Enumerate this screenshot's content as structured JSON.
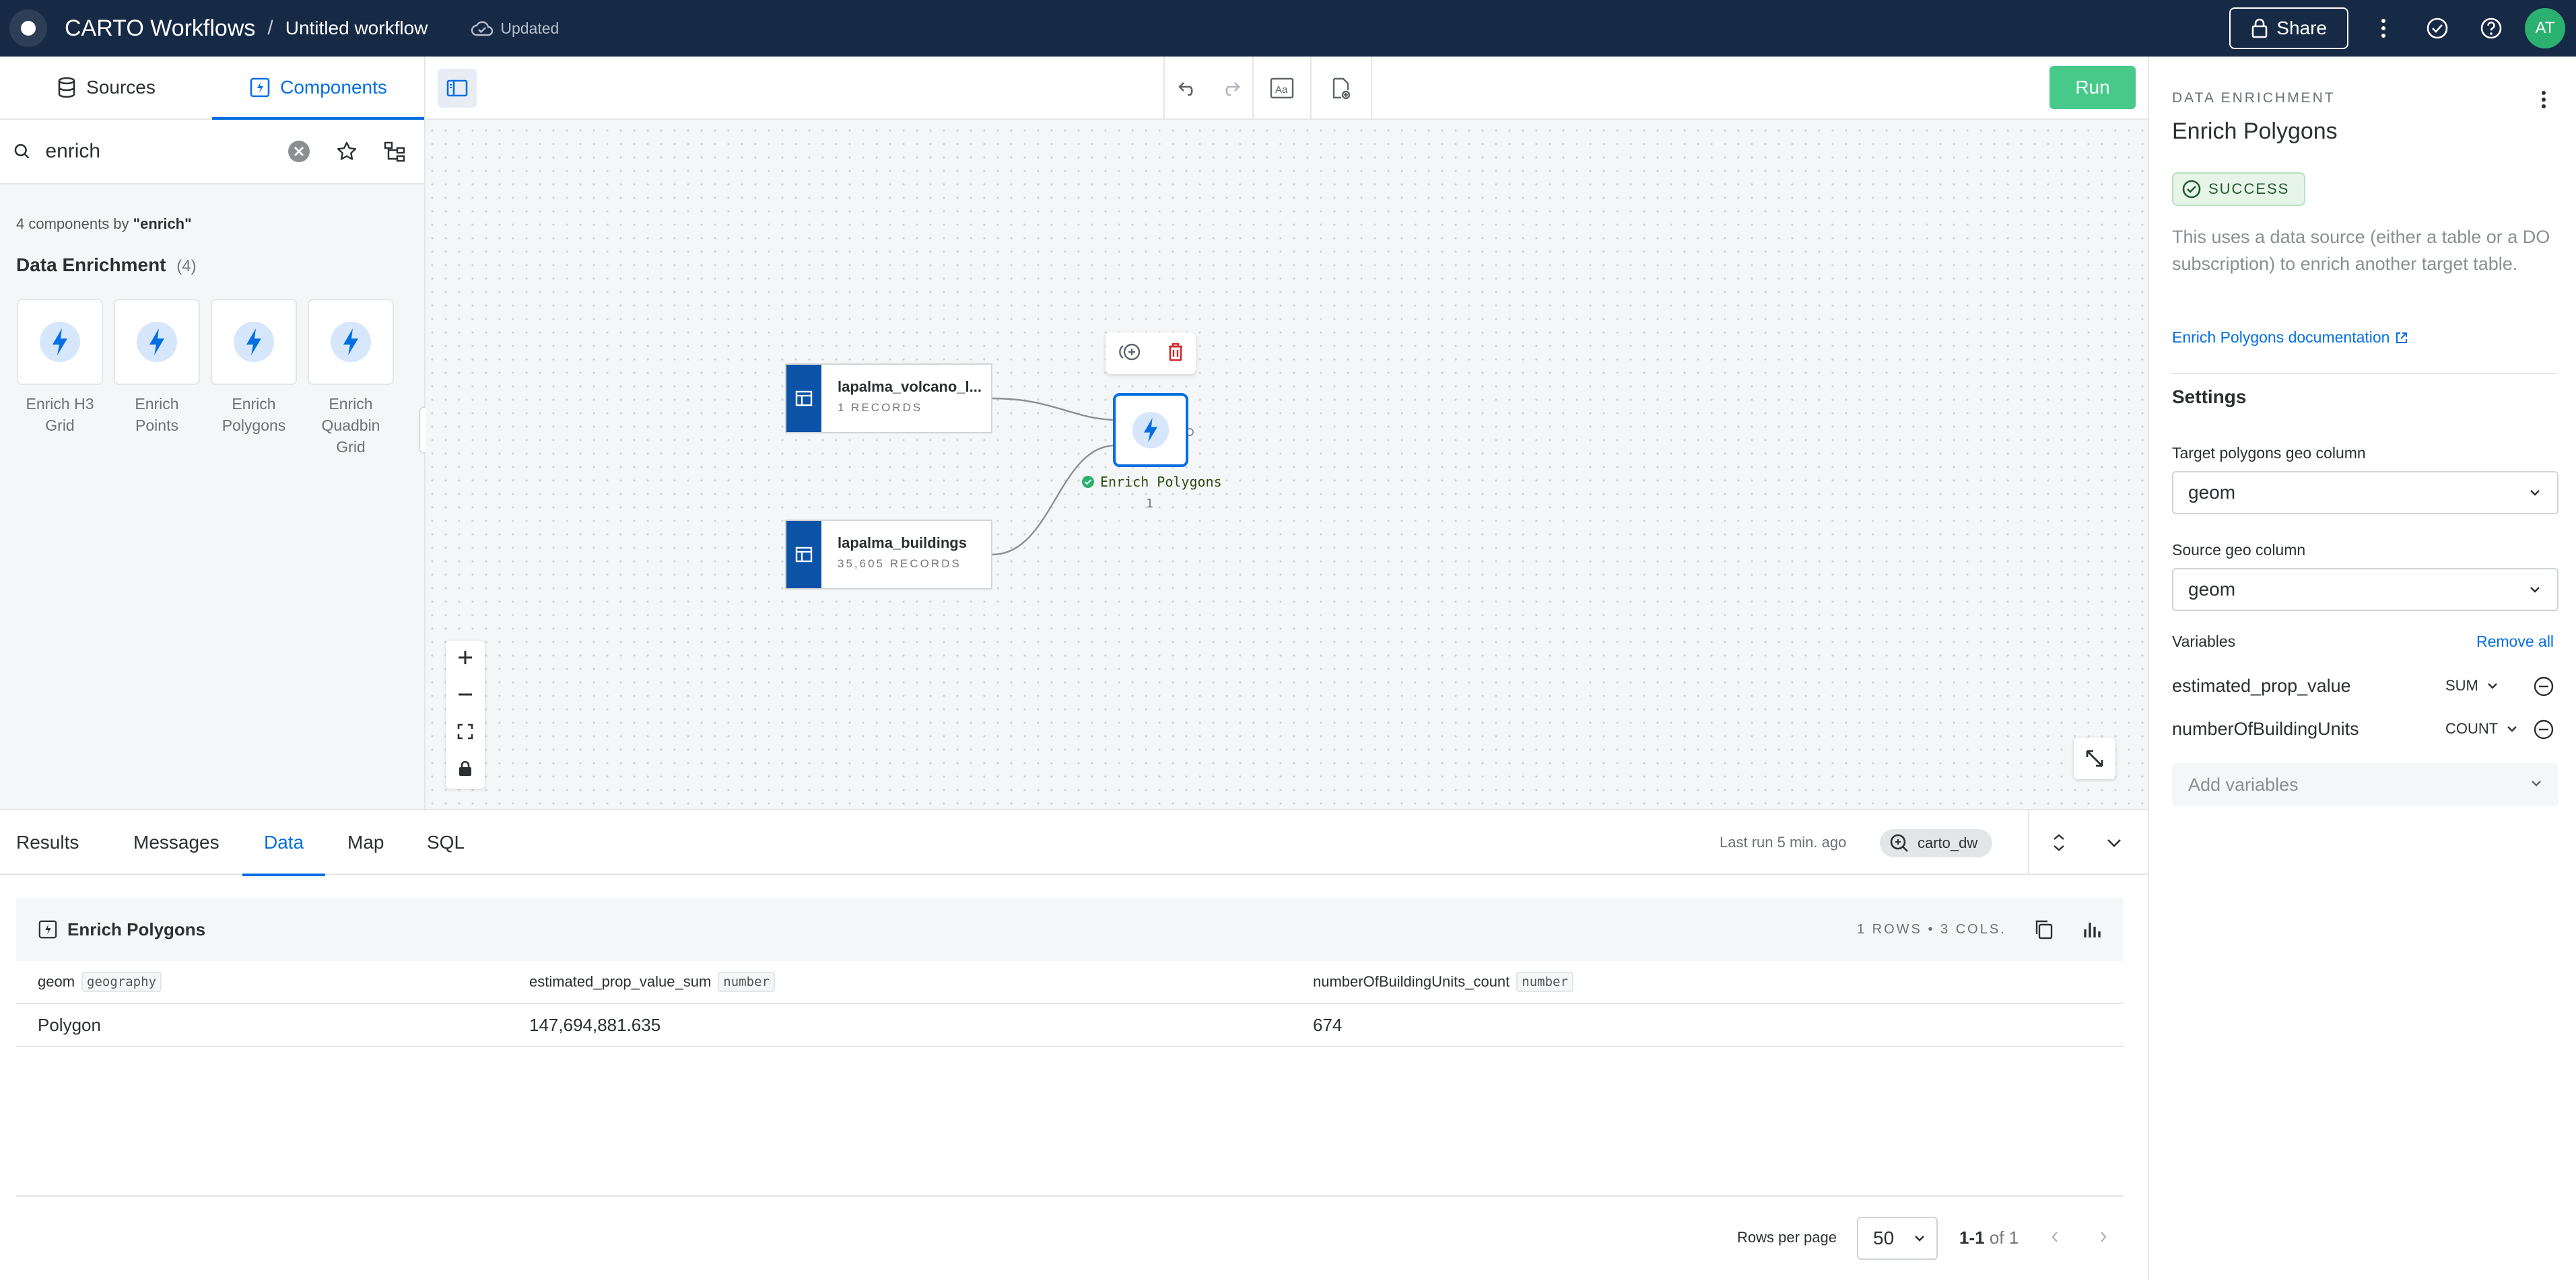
{
  "topbar": {
    "brand": "CARTO Workflows",
    "separator": "/",
    "workflow_name": "Untitled workflow",
    "save_status": "Updated",
    "share_label": "Share",
    "avatar_initials": "AT"
  },
  "left_panel": {
    "tabs": [
      {
        "label": "Sources",
        "icon": "database-icon",
        "active": false
      },
      {
        "label": "Components",
        "icon": "components-icon",
        "active": true
      }
    ],
    "search_value": "enrich",
    "result_count_prefix": "4 components by",
    "result_count_query": "\"enrich\"",
    "group": {
      "title": "Data Enrichment",
      "count": "(4)",
      "items": [
        "Enrich H3 Grid",
        "Enrich Points",
        "Enrich Polygons",
        "Enrich Quadbin Grid"
      ]
    }
  },
  "canvas": {
    "run_label": "Run",
    "nodes": [
      {
        "title": "lapalma_volcano_l...",
        "subtitle": "1 RECORDS"
      },
      {
        "title": "lapalma_buildings",
        "subtitle": "35,605 RECORDS"
      }
    ],
    "enrich_node": {
      "label": "Enrich Polygons",
      "count": "1"
    }
  },
  "bottom_panel": {
    "tabs": [
      {
        "label": "Results",
        "active": false
      },
      {
        "label": "Messages",
        "active": false
      },
      {
        "label": "Data",
        "active": true
      },
      {
        "label": "Map",
        "active": false
      },
      {
        "label": "SQL",
        "active": false
      }
    ],
    "last_run": "Last run 5 min. ago",
    "connection": "carto_dw",
    "result_title": "Enrich Polygons",
    "result_meta": "1 ROWS • 3 COLS.",
    "columns": [
      {
        "name": "geom",
        "type": "geography"
      },
      {
        "name": "estimated_prop_value_sum",
        "type": "number"
      },
      {
        "name": "numberOfBuildingUnits_count",
        "type": "number"
      }
    ],
    "rows": [
      [
        "Polygon",
        "147,694,881.635",
        "674"
      ]
    ],
    "pagination": {
      "rows_per_page_label": "Rows per page",
      "rows_per_page": "50",
      "range": "1-1",
      "of_total": "of 1"
    }
  },
  "right_panel": {
    "category": "DATA ENRICHMENT",
    "title": "Enrich Polygons",
    "status": "SUCCESS",
    "description": "This uses a data source (either a table or a DO subscription) to enrich another target table.",
    "doc_link": "Enrich Polygons documentation",
    "settings_title": "Settings",
    "target_label": "Target polygons geo column",
    "target_value": "geom",
    "source_label": "Source geo column",
    "source_value": "geom",
    "variables_label": "Variables",
    "remove_all": "Remove all",
    "variables": [
      {
        "name": "estimated_prop_value",
        "agg": "SUM"
      },
      {
        "name": "numberOfBuildingUnits",
        "agg": "COUNT"
      }
    ],
    "add_variables": "Add variables"
  },
  "colors": {
    "topbar": "#162945",
    "accent": "#036fe2",
    "run": "#47c98a",
    "node_side": "#0c53a8",
    "success": "#23582c"
  }
}
